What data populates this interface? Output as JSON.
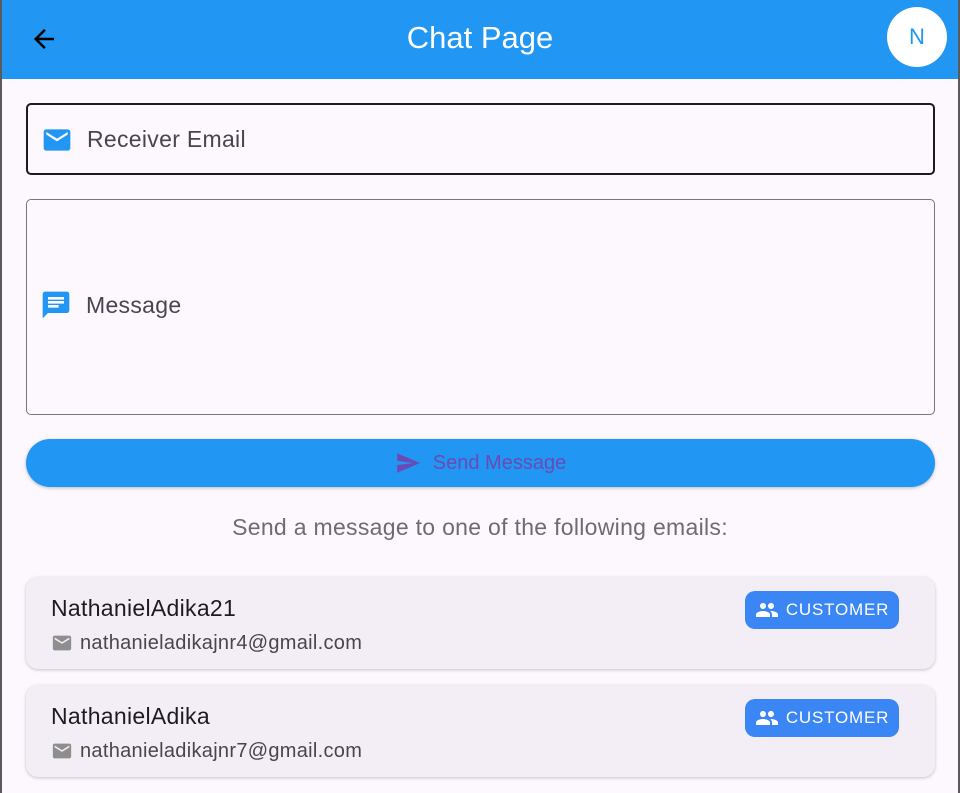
{
  "appbar": {
    "title": "Chat Page",
    "avatar_initial": "N",
    "background": "#2196f3"
  },
  "form": {
    "receiver_email_label": "Receiver Email",
    "message_label": "Message",
    "send_button_label": "Send Message"
  },
  "helper_text": "Send a message to one of the following emails:",
  "contacts": [
    {
      "name": "NathanielAdika21",
      "email": "nathanieladikajnr4@gmail.com",
      "role": "CUSTOMER"
    },
    {
      "name": "NathanielAdika",
      "email": "nathanieladikajnr7@gmail.com",
      "role": "CUSTOMER"
    }
  ],
  "icons": {
    "back": "arrow-back-icon",
    "email": "email-icon",
    "message": "message-icon",
    "send": "send-icon",
    "role": "people-icon"
  },
  "colors": {
    "accent": "#2196f3",
    "badge": "#3a86f5",
    "send_label": "#6a4bb5"
  }
}
